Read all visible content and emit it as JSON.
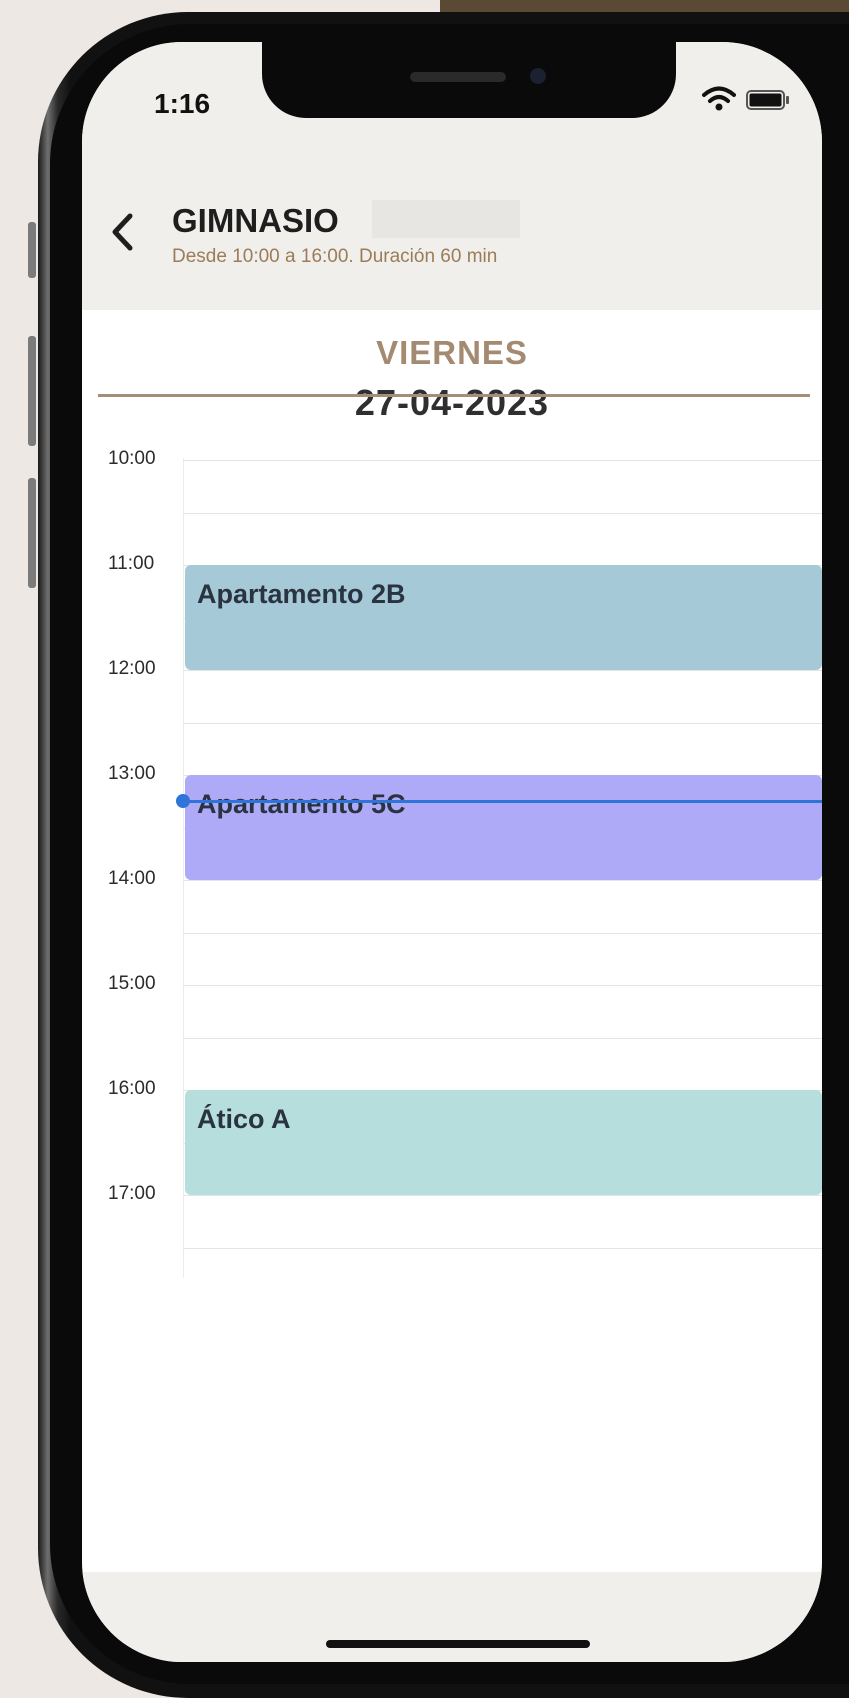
{
  "status_bar": {
    "time": "1:16"
  },
  "nav": {
    "title": "GIMNASIO",
    "subtitle": "Desde 10:00 a 16:00. Duración 60 min"
  },
  "day": {
    "weekday": "VIERNES",
    "date": "27-04-2023"
  },
  "hours": [
    "10:00",
    "11:00",
    "12:00",
    "13:00",
    "14:00",
    "15:00",
    "16:00",
    "17:00"
  ],
  "events": [
    {
      "label": "Apartamento 2B",
      "start": "11:00",
      "end": "12:00",
      "color": "#a6c9d8"
    },
    {
      "label": "Apartamento 5C",
      "start": "13:00",
      "end": "14:00",
      "color": "#aeaaf8"
    },
    {
      "label": "Ático A",
      "start": "16:00",
      "end": "17:00",
      "color": "#b6dedd"
    }
  ],
  "current_time_marker": "13:15",
  "colors": {
    "accent": "#a58e76",
    "now_line": "#2f74d8",
    "header_bg": "#f1efec"
  }
}
